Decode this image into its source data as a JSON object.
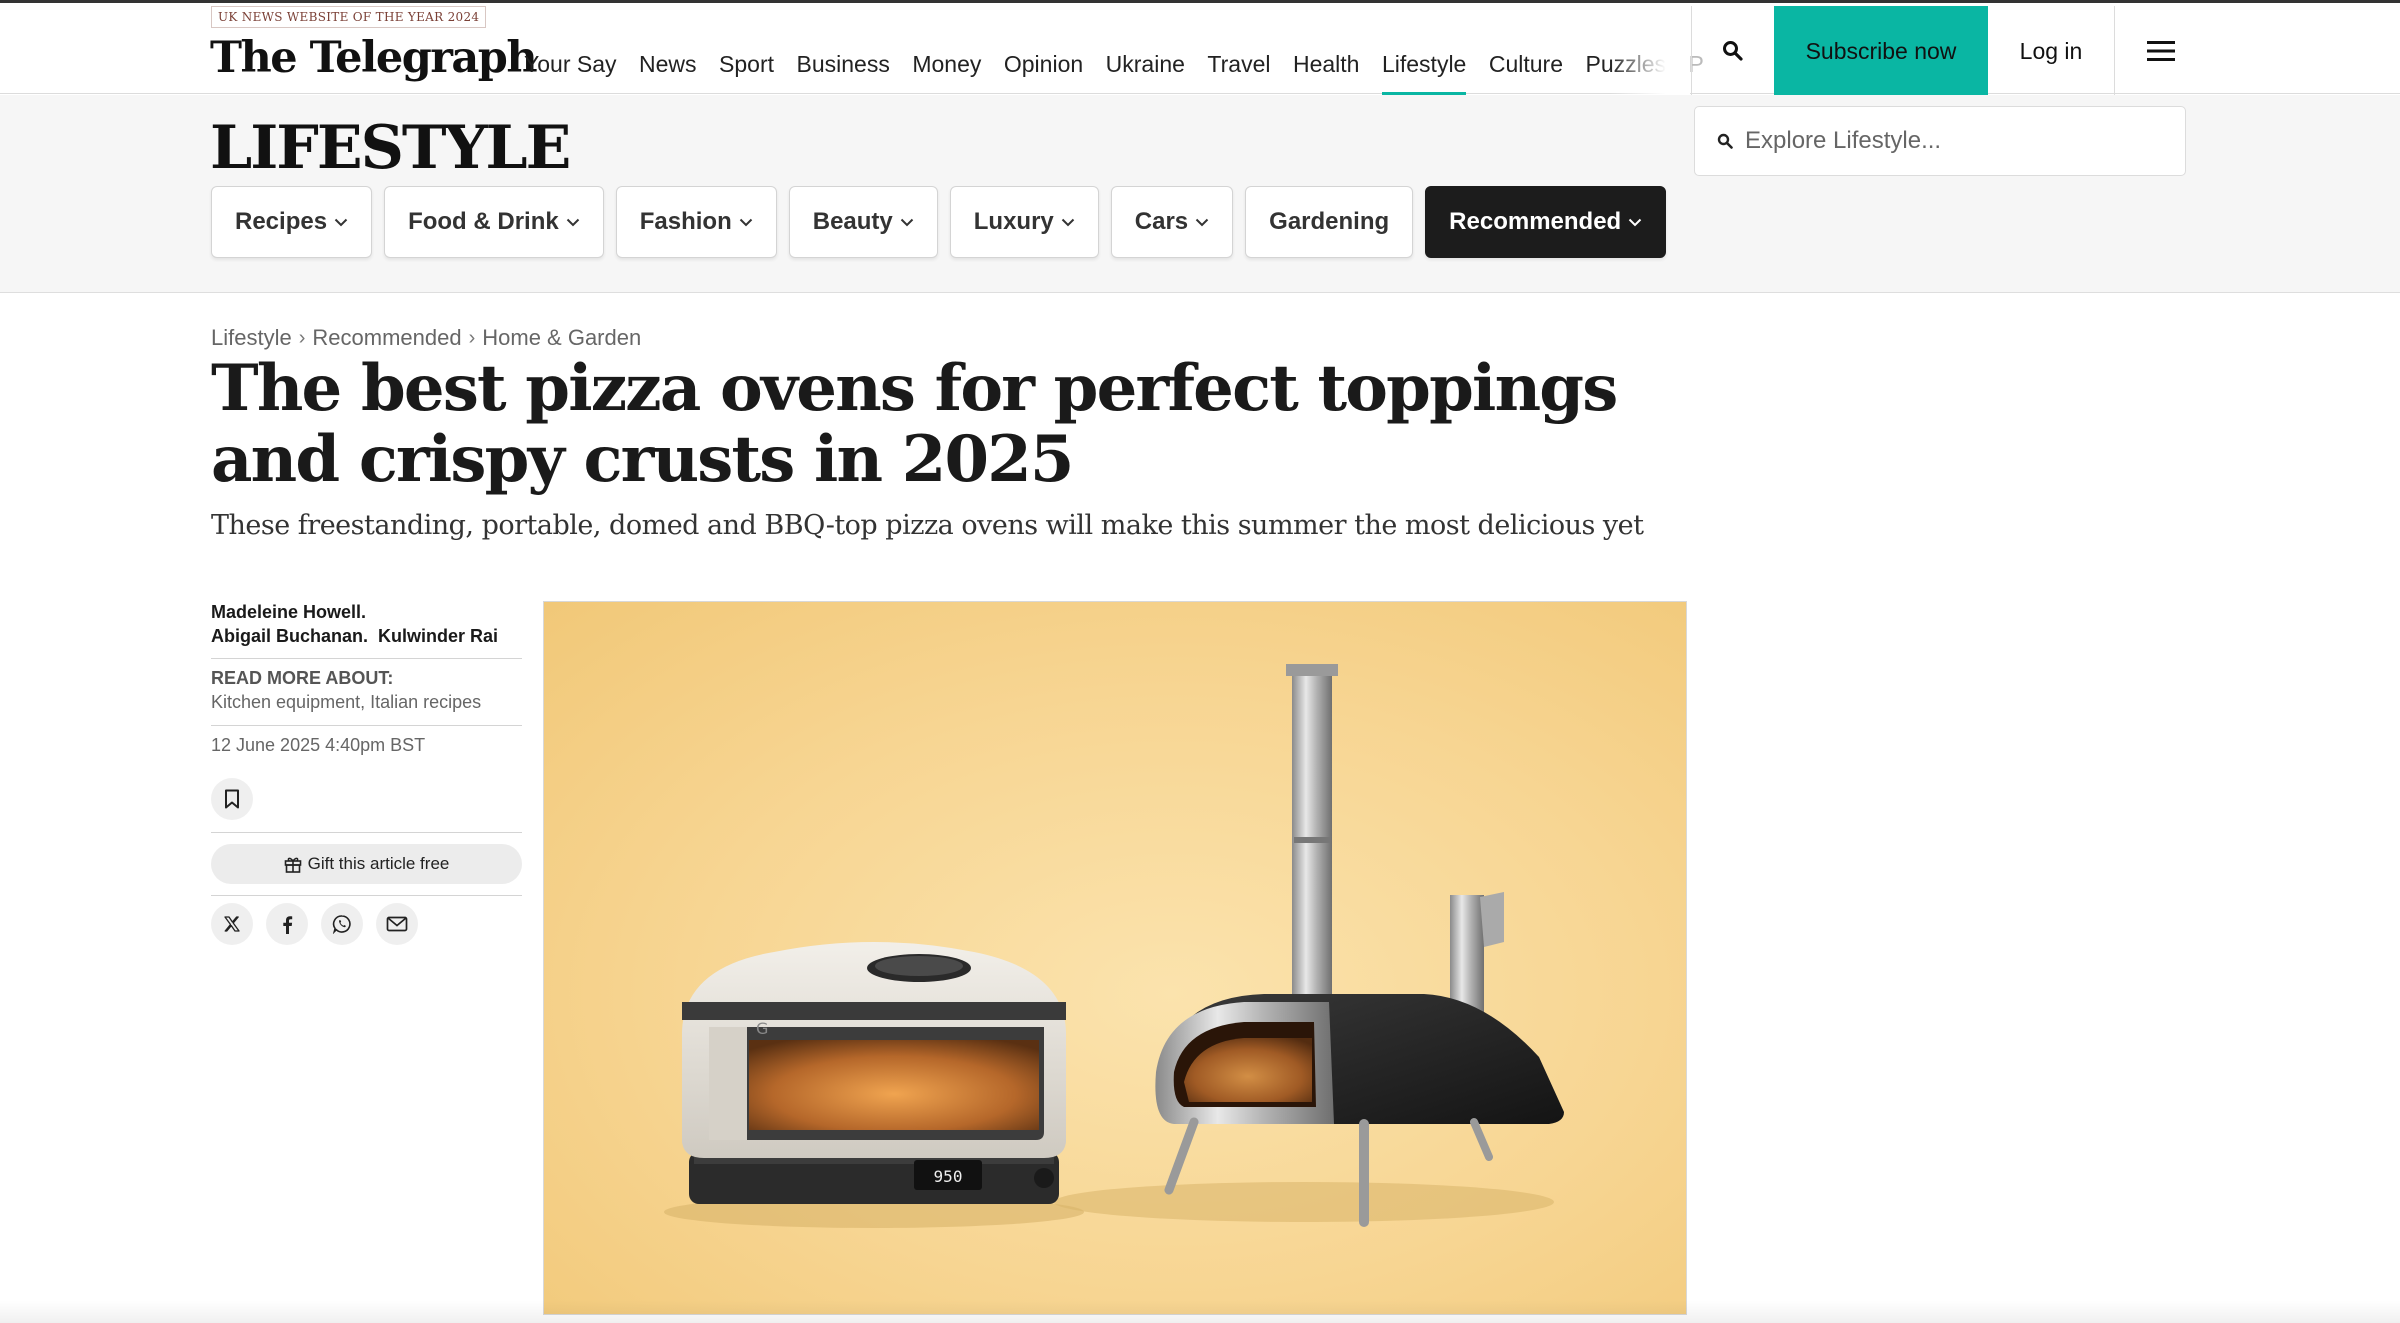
{
  "header": {
    "award": "UK NEWS WEBSITE OF THE YEAR 2024",
    "logo": "The Telegraph",
    "nav": [
      {
        "label": "Your Say"
      },
      {
        "label": "News"
      },
      {
        "label": "Sport"
      },
      {
        "label": "Business"
      },
      {
        "label": "Money"
      },
      {
        "label": "Opinion"
      },
      {
        "label": "Ukraine"
      },
      {
        "label": "Travel"
      },
      {
        "label": "Health"
      },
      {
        "label": "Lifestyle",
        "active": true
      },
      {
        "label": "Culture"
      },
      {
        "label": "Puzzles"
      },
      {
        "label": "P"
      }
    ],
    "search_icon": "search-icon",
    "subscribe_label": "Subscribe now",
    "login_label": "Log in",
    "menu_icon": "hamburger-menu-icon",
    "accent_color": "#0ab6a3"
  },
  "section": {
    "title": "LIFESTYLE",
    "explore_placeholder": "Explore Lifestyle...",
    "subnav": [
      {
        "label": "Recipes",
        "dropdown": true
      },
      {
        "label": "Food & Drink",
        "dropdown": true
      },
      {
        "label": "Fashion",
        "dropdown": true
      },
      {
        "label": "Beauty",
        "dropdown": true
      },
      {
        "label": "Luxury",
        "dropdown": true
      },
      {
        "label": "Cars",
        "dropdown": true
      },
      {
        "label": "Gardening",
        "dropdown": false
      },
      {
        "label": "Recommended",
        "dropdown": true,
        "active": true
      }
    ]
  },
  "article": {
    "breadcrumb": [
      "Lifestyle",
      "Recommended",
      "Home & Garden"
    ],
    "headline": "The best pizza ovens for perfect toppings and crispy crusts in 2025",
    "standfirst": "These freestanding, portable, domed and BBQ-top pizza ovens will make this summer the most delicious yet",
    "authors_line1": "Madeleine Howell.",
    "authors_line2": "Abigail Buchanan.  Kulwinder Rai",
    "read_more_label": "READ MORE ABOUT:",
    "tags": "Kitchen equipment, Italian recipes",
    "date": "12 June 2025 4:40pm BST",
    "gift_label": "Gift this article free",
    "share_icons": [
      "x-icon",
      "facebook-icon",
      "whatsapp-icon",
      "email-icon"
    ],
    "hero_image": {
      "description_icon": "pizza-ovens-image",
      "oven_display": "950",
      "oven_logo": "G"
    }
  }
}
